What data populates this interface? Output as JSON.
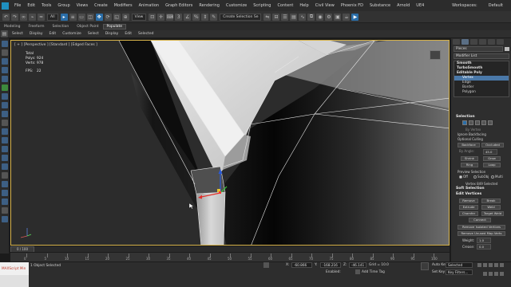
{
  "menu": {
    "items": [
      "File",
      "Edit",
      "Tools",
      "Group",
      "Views",
      "Create",
      "Modifiers",
      "Animation",
      "Graph Editors",
      "Rendering",
      "Customize",
      "Scripting",
      "Content",
      "Help",
      "Civil View",
      "Phoenix FD",
      "Substance",
      "Arnold",
      "UE4"
    ],
    "workspace_label": "Workspaces:",
    "workspace_value": "Default",
    "project_label": "Projects"
  },
  "toolbar": {
    "filter_value": "All",
    "create_selection_set": "Create Selection Se",
    "view_value": "View"
  },
  "ribbon_tabs": [
    "Modeling",
    "Freeform",
    "Selection",
    "Object Paint",
    "Populate"
  ],
  "ribbon_subtabs": [
    "Select",
    "Display",
    "Edit",
    "Selected"
  ],
  "scene_explorer": [
    "Select",
    "Display",
    "Edit",
    "Customize"
  ],
  "viewport": {
    "label": "[ + ] [Perspective ] [Standard ] [Edged Faces ]",
    "stats": {
      "total_label": "Total",
      "polys_label": "Polys:",
      "polys_value": "924",
      "verts_label": "Verts:",
      "verts_value": "978",
      "fps_label": "FPS:",
      "fps_value": "22"
    }
  },
  "timeline": {
    "slider_label": "0 / 100",
    "ticks": [
      "0",
      "5",
      "10",
      "15",
      "20",
      "25",
      "30",
      "35",
      "40",
      "45",
      "50",
      "55",
      "60",
      "65",
      "70",
      "75",
      "80",
      "85",
      "90",
      "95",
      "100"
    ]
  },
  "status": {
    "maxscript_label": "MAXScript Min",
    "selection_message": "1 Object Selected",
    "x_label": "X:",
    "x_value": "-60.866",
    "y_label": "Y:",
    "y_value": "-168.216",
    "z_label": "Z:",
    "z_value": "-46.141",
    "grid_label": "Grid = 10.0",
    "enabled_label": "Enabled:",
    "add_time_tag": "Add Time Tag",
    "auto_key": "Auto Key",
    "selected_label": "Selected",
    "set_key": "Set Key",
    "key_filters": "Key Filters..."
  },
  "command_panel": {
    "object_name": "Pieces",
    "modifier_list": "Modifier List",
    "stack": [
      "Smooth",
      "TurboSmooth",
      "Editable Poly",
      "Vertex",
      "Edge",
      "Border",
      "Polygon"
    ],
    "selection_rollout": "Selection",
    "by_vertex": "By Vertex",
    "ignore_backfacing": "Ignore Backfacing",
    "optional_culling": "Optional Culling",
    "backface": "Backface",
    "occluded": "Occluded",
    "by_angle": "By Angle:",
    "by_angle_value": "45.0",
    "shrink": "Shrink",
    "grow": "Grow",
    "ring": "Ring",
    "loop": "Loop",
    "preview_selection": "Preview Selection",
    "preview_off": "Off",
    "preview_subobj": "SubObj",
    "preview_multi": "Multi",
    "selected_info": "Vertex 849 Selected",
    "soft_selection": "Soft Selection",
    "edit_vertices": "Edit Vertices",
    "remove": "Remove",
    "break": "Break",
    "extrude": "Extrude",
    "weld": "Weld",
    "chamfer": "Chamfer",
    "target_weld": "Target Weld",
    "connect": "Connect",
    "remove_isolated": "Remove Isolated Vertices",
    "remove_unused": "Remove Unused Map Verts",
    "weight_label": "Weight:",
    "weight_value": "1.0",
    "crease_label": "Crease:",
    "crease_value": "0.0"
  },
  "colors": {
    "viewport_border": "#d6b24a",
    "selection_blue": "#4a78a8",
    "gizmo_blue": "#2a5bd8",
    "gizmo_red": "#e0302a",
    "gizmo_green": "#3ac63a"
  }
}
